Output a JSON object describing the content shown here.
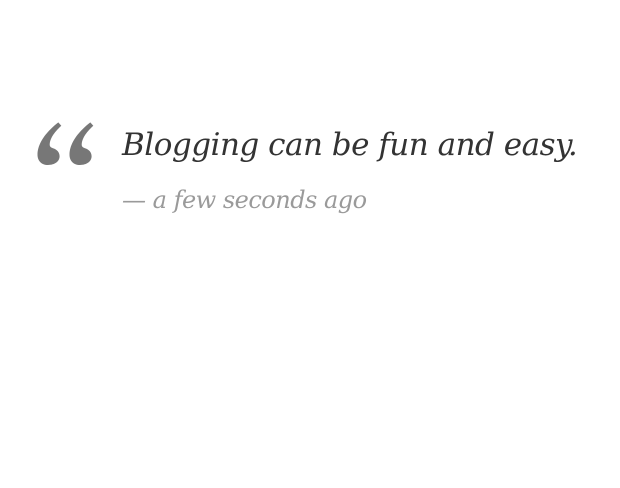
{
  "quote": {
    "icon": "quote-open-icon",
    "text": "Blogging can be fun and easy.",
    "meta": "— a few seconds ago"
  },
  "colors": {
    "quote_mark": "#777777",
    "quote_text": "#333333",
    "meta_text": "#9a9a9a",
    "background": "#ffffff"
  }
}
